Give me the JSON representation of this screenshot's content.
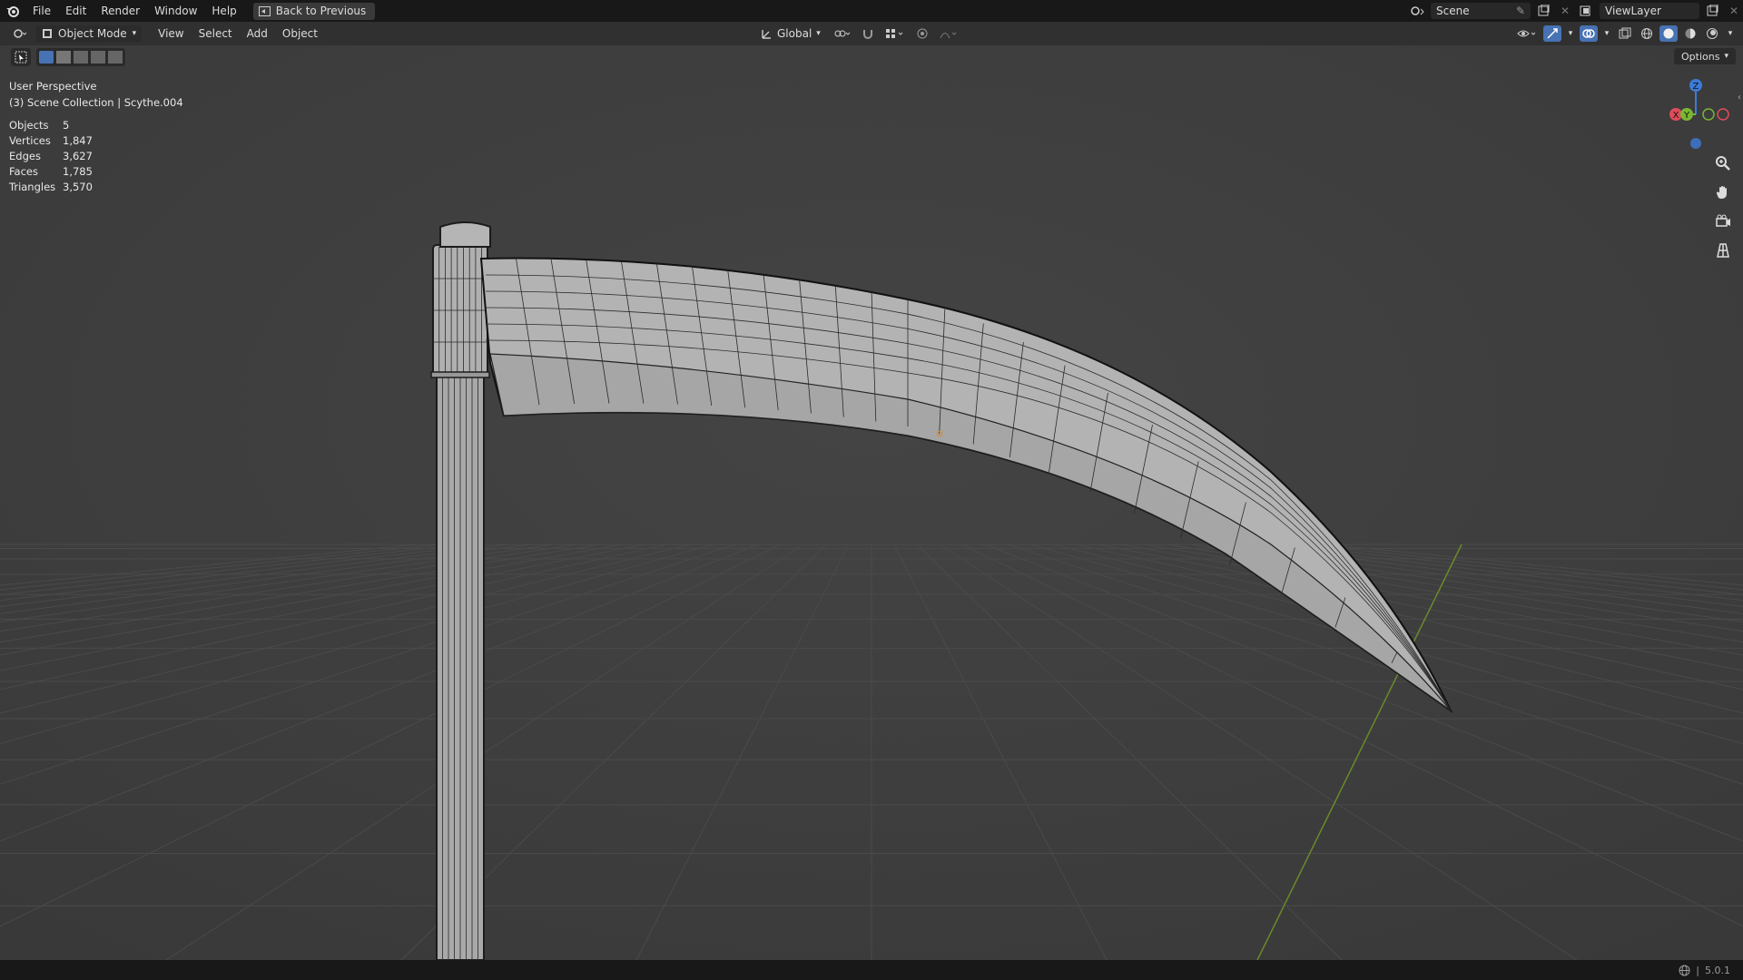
{
  "menu": [
    "File",
    "Edit",
    "Render",
    "Window",
    "Help"
  ],
  "back_button": "Back to Previous",
  "scene": {
    "name": "Scene"
  },
  "view_layer": {
    "name": "ViewLayer"
  },
  "header": {
    "mode": "Object Mode",
    "menus": [
      "View",
      "Select",
      "Add",
      "Object"
    ],
    "transform_orientation": "Global"
  },
  "options_label": "Options",
  "viewport": {
    "perspective_label": "User Perspective",
    "collection_label": "(3) Scene Collection | Scythe.004",
    "stats": [
      {
        "label": "Objects",
        "value": "5"
      },
      {
        "label": "Vertices",
        "value": "1,847"
      },
      {
        "label": "Edges",
        "value": "3,627"
      },
      {
        "label": "Faces",
        "value": "1,785"
      },
      {
        "label": "Triangles",
        "value": "3,570"
      }
    ]
  },
  "gizmo_axes": {
    "z": "Z",
    "y": "Y",
    "x": "X"
  },
  "status": {
    "version": "5.0.1"
  },
  "colors": {
    "x_axis": "#e04c5a",
    "y_axis": "#7ab733",
    "z_axis": "#3d7bd9",
    "active": "#4772b3"
  }
}
